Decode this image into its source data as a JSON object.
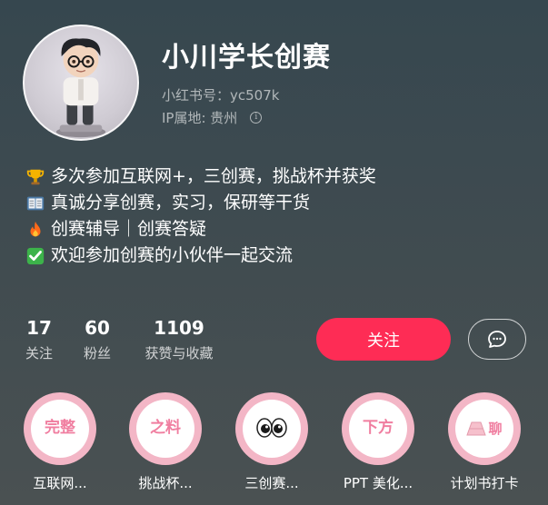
{
  "profile": {
    "name": "小川学长创赛",
    "id_label": "小红书号：yc507k",
    "ip_label": "IP属地: 贵州"
  },
  "bio": [
    {
      "icon": "trophy-icon",
      "text": "多次参加互联网+，三创赛，挑战杯并获奖"
    },
    {
      "icon": "book-icon",
      "text": "真诚分享创赛，实习，保研等干货"
    },
    {
      "icon": "fire-icon",
      "text": "创赛辅导｜创赛答疑"
    },
    {
      "icon": "check-icon",
      "text": "欢迎参加创赛的小伙伴一起交流"
    }
  ],
  "stats": [
    {
      "value": "17",
      "label": "关注"
    },
    {
      "value": "60",
      "label": "粉丝"
    },
    {
      "value": "1109",
      "label": "获赞与收藏"
    }
  ],
  "actions": {
    "follow_label": "关注",
    "accent": "#fe2c55"
  },
  "collections": [
    {
      "badge": "完整",
      "title": "互联网..."
    },
    {
      "badge": "之料",
      "title": "挑战杯..."
    },
    {
      "badge": "",
      "title": "三创赛..."
    },
    {
      "badge": "下方",
      "title": "PPT 美化..."
    },
    {
      "badge": "聊",
      "title": "计划书打卡"
    }
  ]
}
